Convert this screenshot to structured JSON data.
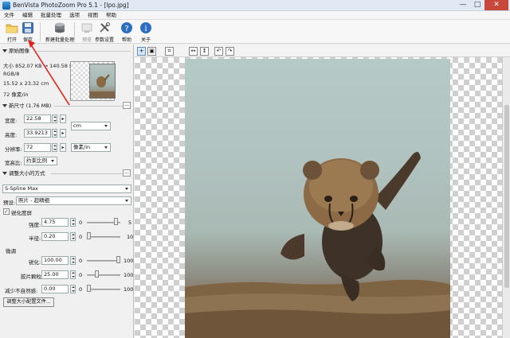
{
  "window": {
    "title": "BenVista PhotoZoom Pro 5.1 - [lpo.jpg]",
    "btn_min": "—",
    "btn_max": "□",
    "btn_close": "✕"
  },
  "menu": {
    "items": [
      "文件",
      "编辑",
      "批量处理",
      "选项",
      "视图",
      "帮助"
    ]
  },
  "toolbar": {
    "open": "打开",
    "save": "保存",
    "batch": "新建批量处理",
    "preview": "预览",
    "settings": "参数设置",
    "help": "帮助",
    "about": "关于"
  },
  "original": {
    "title": "原始图像",
    "size": "大小 852.07 KB → 140.58 KB",
    "mode": "RGB/8",
    "dimensions": "15.52 x 23.32 cm",
    "resolution": "72 像素/in"
  },
  "newsize": {
    "title": "新尺寸 (1.76 MB)",
    "width_label": "宽度:",
    "width_value": "22.58",
    "height_label": "高度:",
    "height_value": "33.9213",
    "unit": "cm",
    "res_label": "分辨率:",
    "res_value": "72",
    "res_unit": "像素/in",
    "aspect_label": "宽高比:",
    "aspect_value": "约束比例",
    "dots": "..."
  },
  "resize": {
    "title": "调整大小的方式",
    "method": "S-Spline Max",
    "preset_label": "预设:",
    "preset_value": "照片 - 超精细",
    "sharpen_label": "锐化度屏",
    "strength_label": "强度:",
    "strength_value": "4.75",
    "strength_min": "0",
    "strength_max": "5",
    "radius_label": "半径:",
    "radius_value": "0.20",
    "radius_min": "0",
    "radius_max": "10",
    "tuning_label": "微调",
    "sharp_label": "锐化:",
    "sharp_value": "100.00",
    "sharp_min": "0",
    "sharp_max": "100",
    "grain_label": "胶片颗粒:",
    "grain_value": "25.00",
    "grain_min": "0",
    "grain_max": "100",
    "artifact_label": "减少不自然感:",
    "artifact_value": "0.00",
    "artifact_min": "0",
    "artifact_max": "100",
    "bottom_button": "调整大小配置文件..."
  },
  "canvas_tools": {
    "zoom_in": "+",
    "crop": "⌗",
    "fit_width": "↔",
    "fit_height": "↕",
    "rotate_left": "↶",
    "rotate_right": "↷"
  },
  "colors": {
    "accent": "#3a7fd0",
    "arrow": "#e0231b",
    "sky": "#b5c9c6",
    "ground": "#8b7357"
  },
  "sliders": {
    "strength": 0.95,
    "radius": 0.02,
    "sharp": 1.0,
    "grain": 0.25,
    "artifact": 0.0
  }
}
